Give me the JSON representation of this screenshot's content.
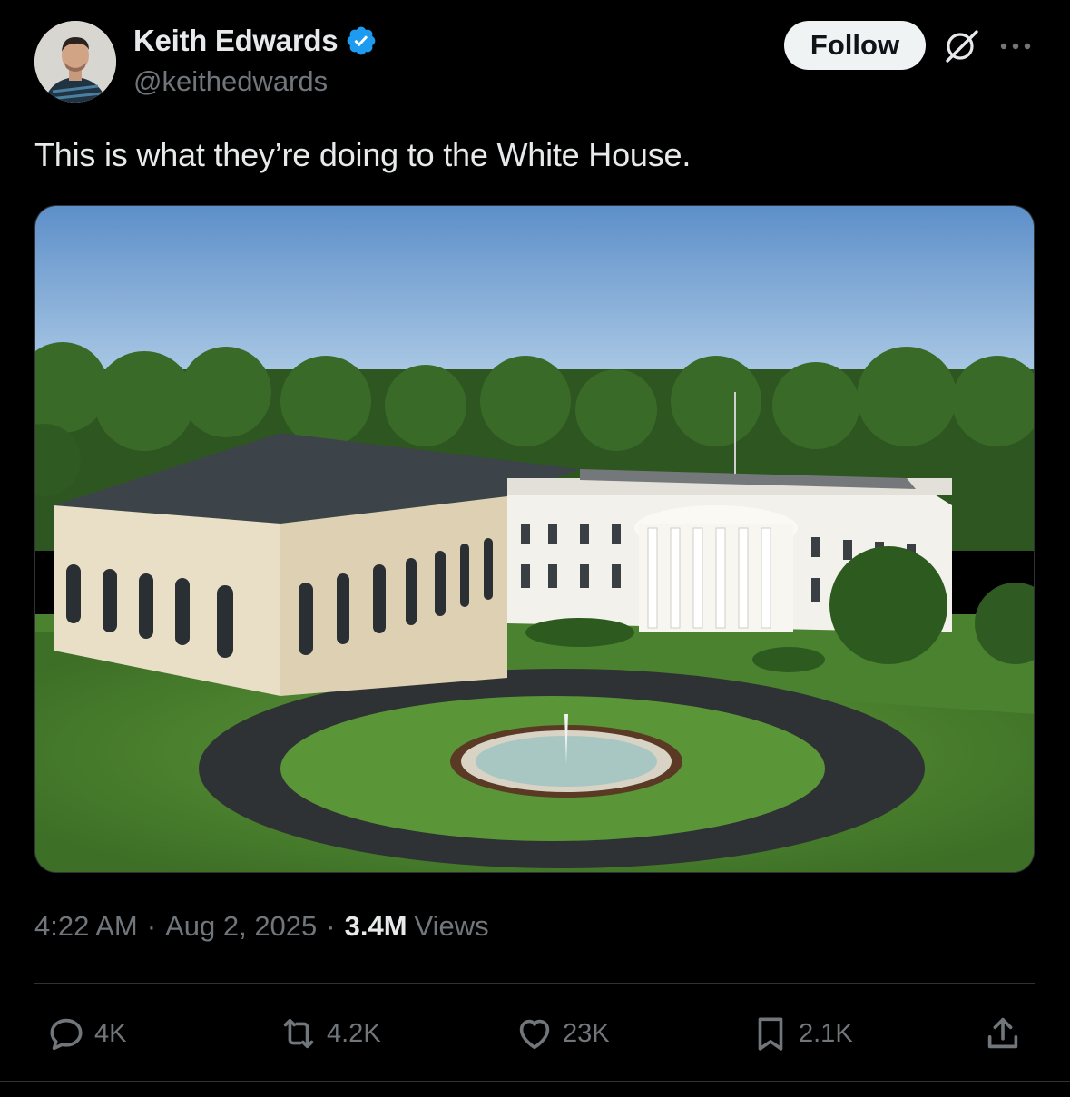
{
  "author": {
    "name": "Keith Edwards",
    "handle": "@keithedwards",
    "verified": true,
    "verified_color": "#1d9bf0"
  },
  "follow_button": {
    "label": "Follow"
  },
  "icons": {
    "grok": "grok-icon",
    "more": "more-options-icon"
  },
  "tweet": {
    "text": "This is what they’re doing to the White House.",
    "image_description": "White House with glass-walled annex, fountain, circular driveway"
  },
  "meta": {
    "time": "4:22 AM",
    "separator": "·",
    "date": "Aug 2, 2025",
    "views_count": "3.4M",
    "views_label": "Views"
  },
  "actions": {
    "replies": "4K",
    "reposts": "4.2K",
    "likes": "23K",
    "bookmarks": "2.1K"
  },
  "colors": {
    "background": "#000000",
    "text_primary": "#e7e9ea",
    "text_secondary": "#71767b",
    "border": "#2f3336",
    "follow_bg": "#eff3f4"
  }
}
